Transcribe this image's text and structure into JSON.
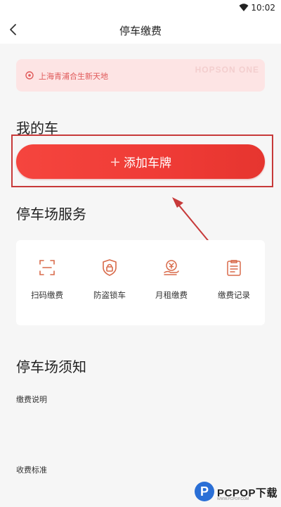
{
  "status_bar": {
    "time": "10:02",
    "wifi_icon": "wifi-icon"
  },
  "header": {
    "title": "停车缴费",
    "back_icon": "chevron-left-icon"
  },
  "location": {
    "text": "上海青浦合生新天地",
    "icon": "location-pin-icon",
    "watermark": "HOPSON ONE"
  },
  "my_car": {
    "title": "我的车",
    "add_plate_label": "添加车牌",
    "plus": "+"
  },
  "services": {
    "title": "停车场服务",
    "items": [
      {
        "label": "扫码缴费",
        "icon": "scan-icon"
      },
      {
        "label": "防盗锁车",
        "icon": "lock-shield-icon"
      },
      {
        "label": "月租缴费",
        "icon": "monthly-yen-icon"
      },
      {
        "label": "缴费记录",
        "icon": "payment-record-icon"
      }
    ]
  },
  "notice": {
    "title": "停车场须知",
    "items": [
      {
        "label": "缴费说明"
      },
      {
        "label": "收费标准"
      }
    ]
  },
  "brand": {
    "logo_letter": "P",
    "name": "PCPOP下载",
    "sub": "WWW.PCPOP.COM"
  },
  "colors": {
    "accent": "#ef3b36",
    "annotation": "#c73a3a",
    "location_bg": "#fde4e4",
    "icon_stroke": "#d86a4a"
  }
}
